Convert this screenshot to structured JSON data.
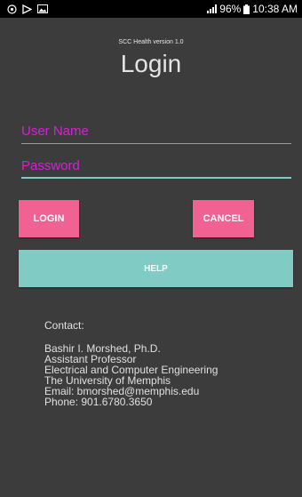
{
  "status_bar": {
    "battery": "96%",
    "time": "10:38 AM",
    "icons": [
      "sync-icon",
      "play-store-icon",
      "image-icon",
      "signal-icon",
      "battery-icon"
    ]
  },
  "app": {
    "version": "SCC Health version 1.0",
    "title": "Login"
  },
  "form": {
    "username_placeholder": "User Name",
    "password_placeholder": "Password",
    "accent_color": "#f06292",
    "secondary_color": "#80cbc4"
  },
  "buttons": {
    "login": "LOGIN",
    "cancel": "CANCEL",
    "help": "HELP"
  },
  "contact": {
    "heading": "Contact:",
    "lines": [
      "Bashir I. Morshed, Ph.D.",
      "Assistant Professor",
      "Electrical and Computer Engineering",
      "The University of Memphis",
      "Email: bmorshed@memphis.edu",
      "Phone: 901.6780.3650"
    ]
  }
}
